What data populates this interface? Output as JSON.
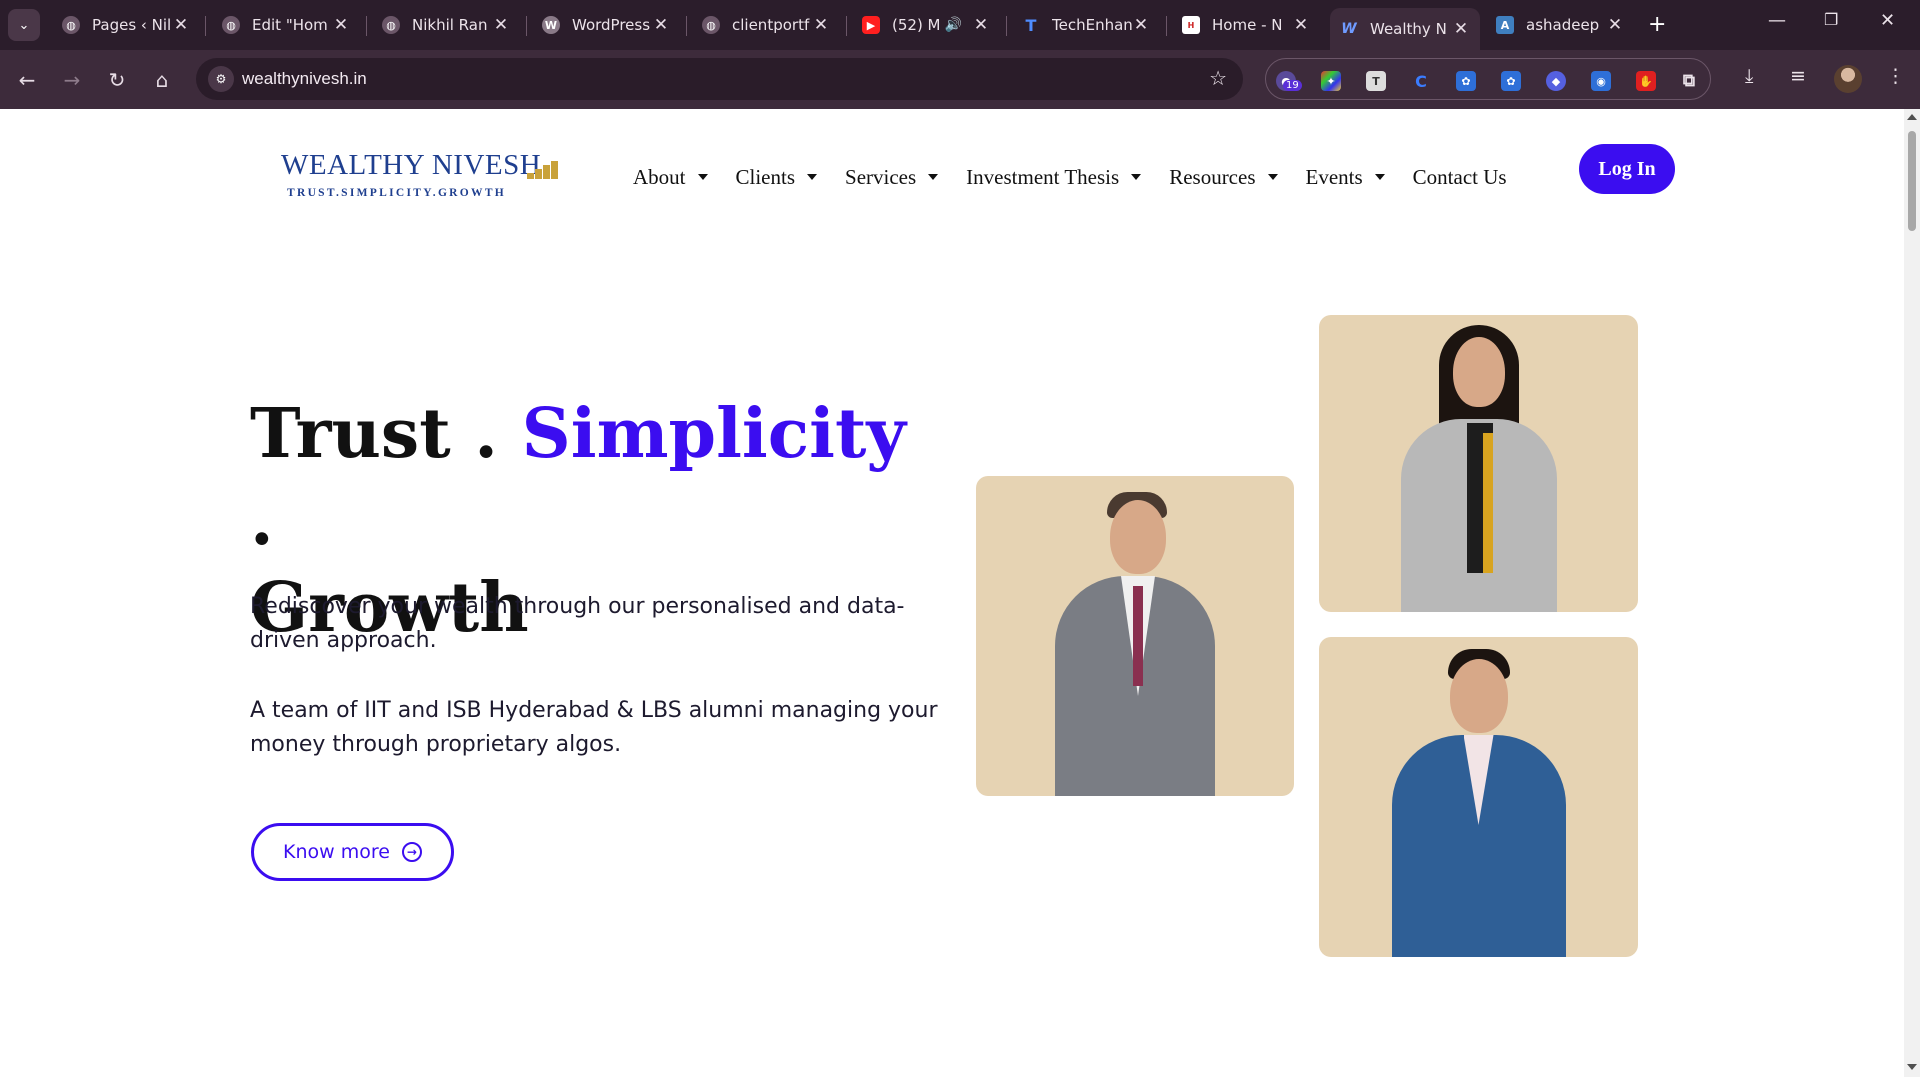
{
  "browser": {
    "tabs": [
      {
        "title": "Pages ‹ Nil",
        "icon": "globe-icon",
        "active": false
      },
      {
        "title": "Edit \"Hom",
        "icon": "globe-icon",
        "active": false
      },
      {
        "title": "Nikhil Ran",
        "icon": "globe-icon",
        "active": false
      },
      {
        "title": "WordPress",
        "icon": "wordpress-icon",
        "active": false
      },
      {
        "title": "clientportf",
        "icon": "globe-icon",
        "active": false
      },
      {
        "title": "(52) M",
        "icon": "youtube-icon",
        "active": false
      },
      {
        "title": "TechEnhan",
        "icon": "techenhance-icon",
        "active": false
      },
      {
        "title": "Home - N",
        "icon": "site-icon",
        "active": false
      },
      {
        "title": "Wealthy N",
        "icon": "wealthy-icon",
        "active": true
      },
      {
        "title": "ashadeep",
        "icon": "ashadeep-icon",
        "active": false
      }
    ],
    "url": "wealthynivesh.in",
    "extension_badge": "19"
  },
  "site": {
    "logo": {
      "wordmark": "WEALTHY NIVESH",
      "tagline": "TRUST.SIMPLICITY.GROWTH"
    },
    "nav": [
      {
        "label": "About",
        "dropdown": true
      },
      {
        "label": "Clients",
        "dropdown": true
      },
      {
        "label": "Services",
        "dropdown": true
      },
      {
        "label": "Investment Thesis",
        "dropdown": true
      },
      {
        "label": "Resources",
        "dropdown": true
      },
      {
        "label": "Events",
        "dropdown": true
      },
      {
        "label": "Contact Us",
        "dropdown": false
      }
    ],
    "login_label": "Log In"
  },
  "hero": {
    "headline_part1": "Trust . ",
    "headline_accent": "Simplicity",
    "headline_part2": " .",
    "headline_part3": "Growth",
    "paragraph1": "Rediscover your wealth through our personalised and data-driven approach.",
    "paragraph2": "A team of IIT and ISB Hyderabad & LBS alumni managing your money through proprietary algos.",
    "cta_label": "Know more"
  },
  "colors": {
    "accent": "#3b0df0",
    "photo_bg": "#e6d3b3",
    "logo_blue": "#1f3f8f",
    "logo_gold": "#c9a23a"
  }
}
